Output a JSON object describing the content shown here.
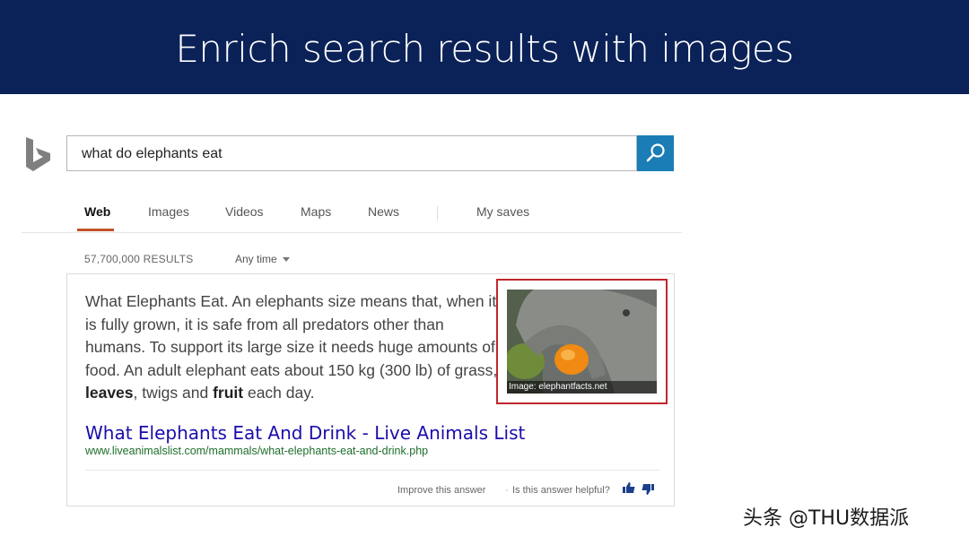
{
  "banner": {
    "title": "Enrich search results with images"
  },
  "search": {
    "query": "what do elephants eat"
  },
  "tabs": [
    {
      "label": "Web",
      "active": true
    },
    {
      "label": "Images",
      "active": false
    },
    {
      "label": "Videos",
      "active": false
    },
    {
      "label": "Maps",
      "active": false
    },
    {
      "label": "News",
      "active": false
    },
    {
      "label": "My saves",
      "active": false
    }
  ],
  "filters": {
    "results_count": "57,700,000 RESULTS",
    "time_filter": "Any time"
  },
  "answer": {
    "text_start": "What Elephants Eat. An elephants size means that, when it is fully grown, it is safe from all predators other than humans. To support its large size it needs huge amounts of food. An adult elephant eats about 150 kg (300 lb) of grass, ",
    "bold_1": "leaves",
    "text_mid": ", twigs and ",
    "bold_2": "fruit",
    "text_end": " each day.",
    "image_caption": "Image: elephantfacts.net",
    "result_title": "What Elephants Eat And Drink - Live Animals List",
    "result_url": "www.liveanimalslist.com/mammals/what-elephants-eat-and-drink.php",
    "improve_label": "Improve this answer",
    "separator": "·",
    "helpful_label": "Is this answer helpful?"
  },
  "watermark": "头条 @THU数据派",
  "colors": {
    "banner": "#0b2258",
    "search_button": "#1a7db5",
    "highlight_border": "#c0272d",
    "link": "#1a0dab",
    "url": "#1e6e2b"
  }
}
